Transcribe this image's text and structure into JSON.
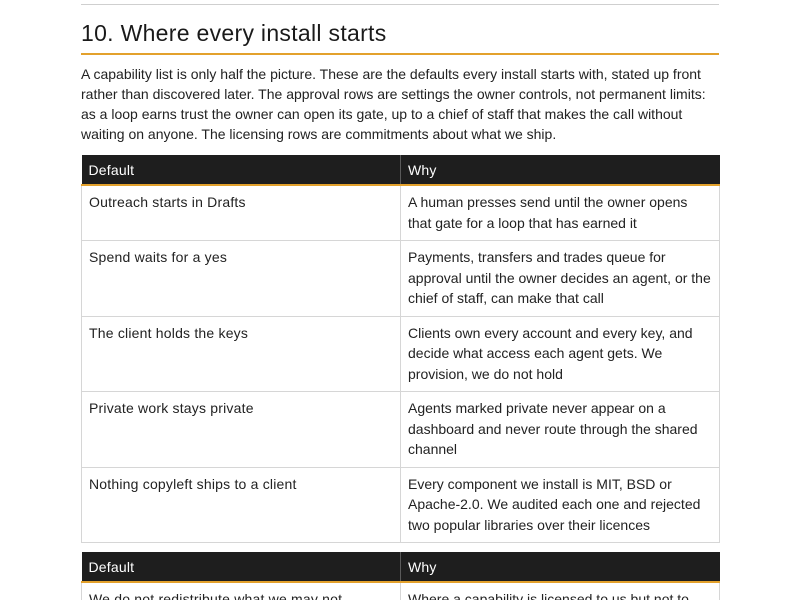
{
  "section": {
    "heading": "10. Where every install starts",
    "intro": "A capability list is only half the picture. These are the defaults every install starts with, stated up front rather than discovered later. The approval rows are settings the owner controls, not permanent limits: as a loop earns trust the owner can open its gate, up to a chief of staff that makes the call without waiting on anyone. The licensing rows are commitments about what we ship."
  },
  "table1": {
    "headers": [
      "Default",
      "Why"
    ],
    "rows": [
      {
        "default": "Outreach starts in Drafts",
        "why": "A human presses send until the owner opens that gate for a loop that has earned it"
      },
      {
        "default": "Spend waits for a yes",
        "why": "Payments, transfers and trades queue for approval until the owner decides an agent, or the chief of staff, can make that call"
      },
      {
        "default": "The client holds the keys",
        "why": "Clients own every account and every key, and decide what access each agent gets. We provision, we do not hold"
      },
      {
        "default": "Private work stays private",
        "why": "Agents marked private never appear on a dashboard and never route through the shared channel"
      },
      {
        "default": "Nothing copyleft ships to a client",
        "why": "Every component we install is MIT, BSD or Apache-2.0. We audited each one and rejected two popular libraries over their licences"
      }
    ]
  },
  "table2": {
    "headers": [
      "Default",
      "Why"
    ],
    "rows": [
      {
        "default": "We do not redistribute what we may not",
        "why": "Where a capability is licensed to us but not to"
      }
    ]
  }
}
